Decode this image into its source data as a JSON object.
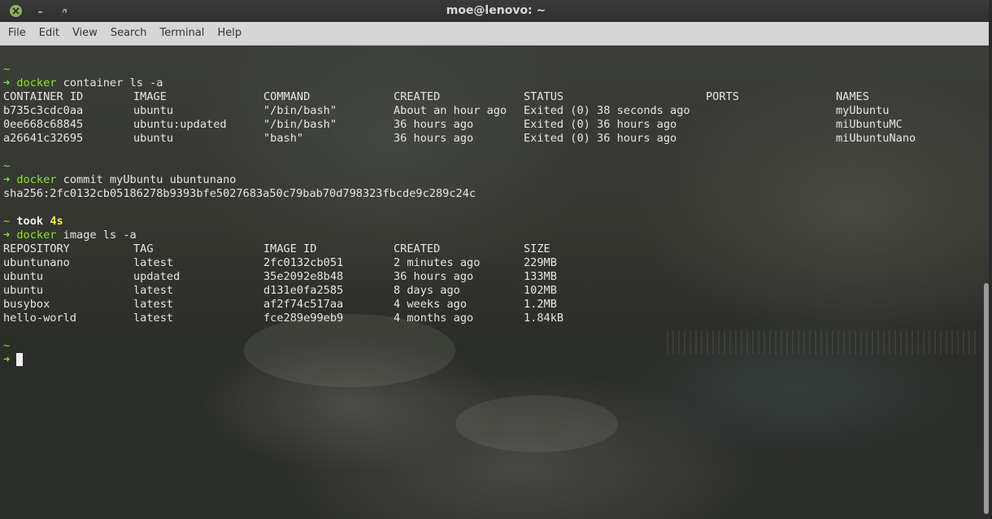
{
  "window": {
    "title": "moe@lenovo: ~"
  },
  "menu": [
    "File",
    "Edit",
    "View",
    "Search",
    "Terminal",
    "Help"
  ],
  "terminal": {
    "prompt_tilde": "~",
    "prompt_arrow": "➜",
    "cmd1": {
      "program": "docker",
      "args": "container ls -a"
    },
    "containers": {
      "headers": [
        "CONTAINER ID",
        "IMAGE",
        "COMMAND",
        "CREATED",
        "STATUS",
        "PORTS",
        "NAMES"
      ],
      "rows": [
        [
          "b735c3cdc0aa",
          "ubuntu",
          "\"/bin/bash\"",
          "About an hour ago",
          "Exited (0) 38 seconds ago",
          "",
          "myUbuntu"
        ],
        [
          "0ee668c68845",
          "ubuntu:updated",
          "\"/bin/bash\"",
          "36 hours ago",
          "Exited (0) 36 hours ago",
          "",
          "miUbuntuMC"
        ],
        [
          "a26641c32695",
          "ubuntu",
          "\"bash\"",
          "36 hours ago",
          "Exited (0) 36 hours ago",
          "",
          "miUbuntuNano"
        ]
      ]
    },
    "cmd2": {
      "program": "docker",
      "args": "commit myUbuntu ubuntunano"
    },
    "commit_output": "sha256:2fc0132cb05186278b9393bfe5027683a50c79bab70d798323fbcde9c289c24c",
    "took": {
      "label": "took",
      "value": "4s"
    },
    "cmd3": {
      "program": "docker",
      "args": "image ls -a"
    },
    "images": {
      "headers": [
        "REPOSITORY",
        "TAG",
        "IMAGE ID",
        "CREATED",
        "SIZE"
      ],
      "rows": [
        [
          "ubuntunano",
          "latest",
          "2fc0132cb051",
          "2 minutes ago",
          "229MB"
        ],
        [
          "ubuntu",
          "updated",
          "35e2092e8b48",
          "36 hours ago",
          "133MB"
        ],
        [
          "ubuntu",
          "latest",
          "d131e0fa2585",
          "8 days ago",
          "102MB"
        ],
        [
          "busybox",
          "latest",
          "af2f74c517aa",
          "4 weeks ago",
          "1.2MB"
        ],
        [
          "hello-world",
          "latest",
          "fce289e99eb9",
          "4 months ago",
          "1.84kB"
        ]
      ]
    }
  },
  "colors": {
    "prompt_green": "#8ae234",
    "took_yellow": "#fce94f",
    "close_button": "#8fb05a"
  },
  "icons": {
    "close": "close-icon",
    "minimize": "minimize-icon",
    "maximize": "maximize-icon"
  }
}
